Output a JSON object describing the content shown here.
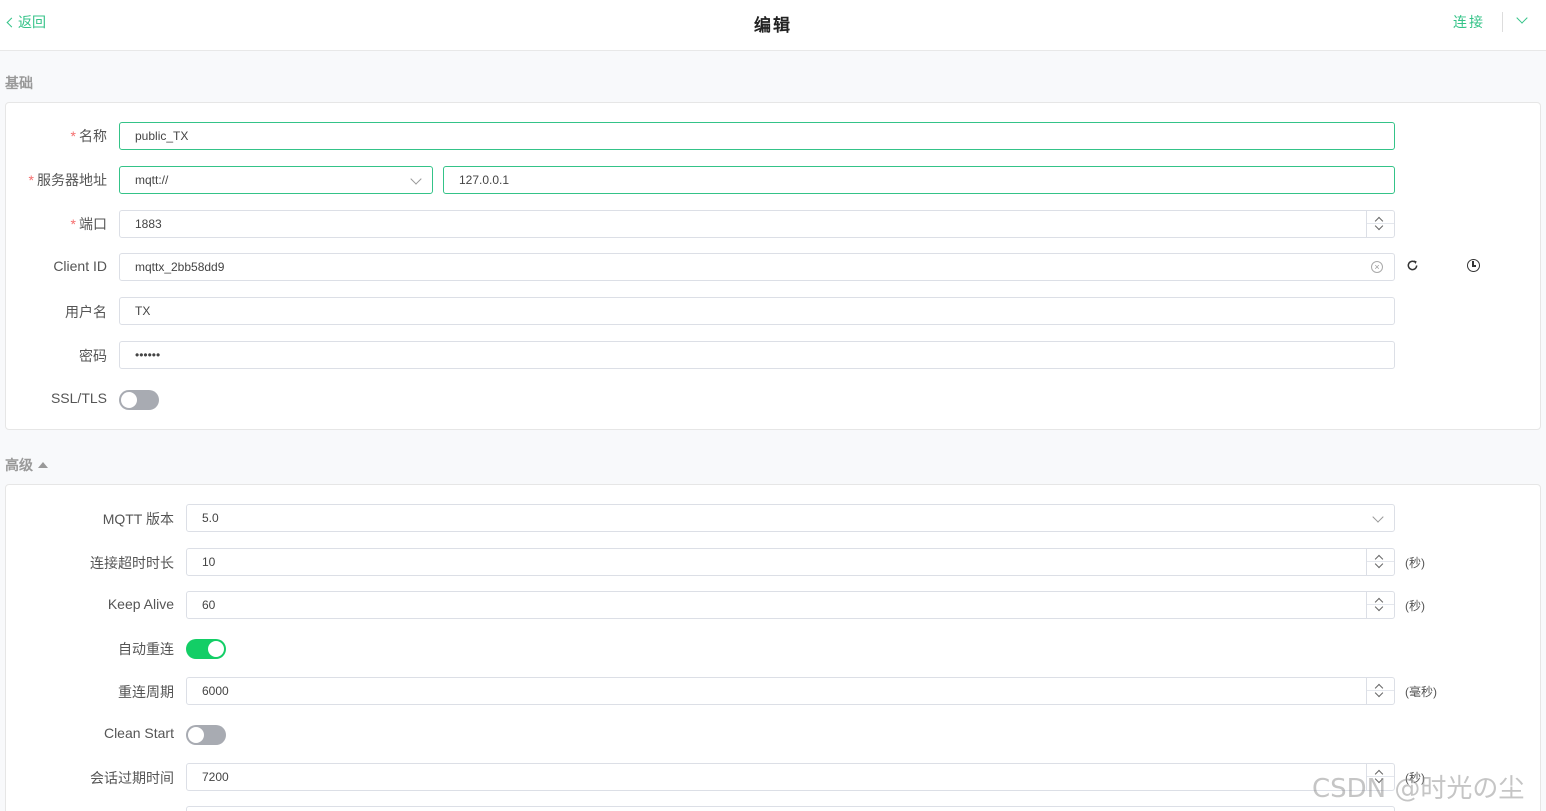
{
  "header": {
    "back_label": "返回",
    "title": "编辑",
    "connect_label": "连接"
  },
  "basic": {
    "section_title": "基础",
    "name": {
      "label": "名称",
      "value": "public_TX"
    },
    "server": {
      "label": "服务器地址",
      "protocol": "mqtt://",
      "host": "127.0.0.1"
    },
    "port": {
      "label": "端口",
      "value": "1883"
    },
    "client_id": {
      "label": "Client ID",
      "value": "mqttx_2bb58dd9"
    },
    "username": {
      "label": "用户名",
      "value": "TX"
    },
    "password": {
      "label": "密码",
      "value": "••••••"
    },
    "ssl": {
      "label": "SSL/TLS",
      "enabled": false
    }
  },
  "advanced": {
    "section_title": "高级",
    "mqtt_version": {
      "label": "MQTT 版本",
      "value": "5.0"
    },
    "connect_timeout": {
      "label": "连接超时时长",
      "value": "10",
      "unit": "(秒)"
    },
    "keep_alive": {
      "label": "Keep Alive",
      "value": "60",
      "unit": "(秒)"
    },
    "auto_reconnect": {
      "label": "自动重连",
      "enabled": true
    },
    "reconnect_period": {
      "label": "重连周期",
      "value": "6000",
      "unit": "(毫秒)"
    },
    "clean_start": {
      "label": "Clean Start",
      "enabled": false
    },
    "session_expiry": {
      "label": "会话过期时间",
      "value": "7200",
      "unit": "(秒)"
    }
  },
  "required_mark": "*",
  "watermark": "CSDN @时光の尘",
  "colors": {
    "accent": "#34c388",
    "toggle_on": "#13ce66",
    "toggle_off": "#a8abb2",
    "required": "#f56c6c"
  }
}
